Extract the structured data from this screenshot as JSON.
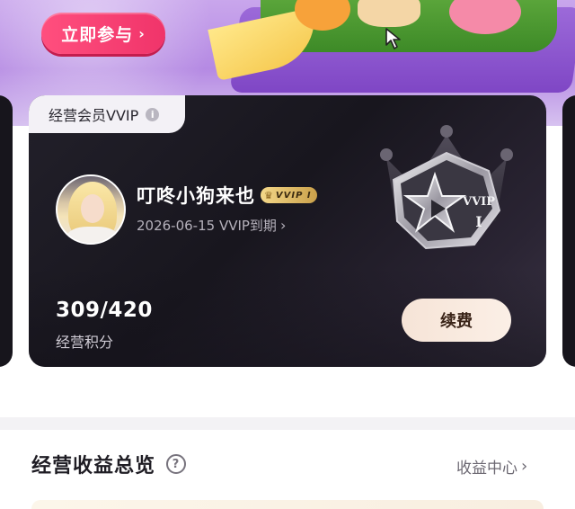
{
  "banner": {
    "join_label": "立即参与",
    "join_chevron": "›"
  },
  "member_card": {
    "tag_label": "经营会员VVIP",
    "info_icon": "i",
    "username": "叮咚小狗来也",
    "badge_label": "VVIP Ⅰ",
    "badge_crown": "♛",
    "expire_text": "2026-06-15 VVIP到期",
    "expire_chevron": "›",
    "medal_label": "VVIP",
    "medal_level": "I",
    "points_value": "309/420",
    "points_label": "经营积分",
    "renew_label": "续费"
  },
  "overview": {
    "title": "经营收益总览",
    "help_icon": "?",
    "link_label": "收益中心",
    "link_chevron": "›"
  },
  "colors": {
    "join_button": "#f0346a",
    "card_bg": "#18161e",
    "renew_button": "#f6e4d7",
    "banner_bg": "#b58ae3"
  },
  "icons": [
    "cursor-icon",
    "info-icon",
    "crown-icon",
    "chevron-right-icon",
    "vvip-medal-icon",
    "help-icon"
  ]
}
